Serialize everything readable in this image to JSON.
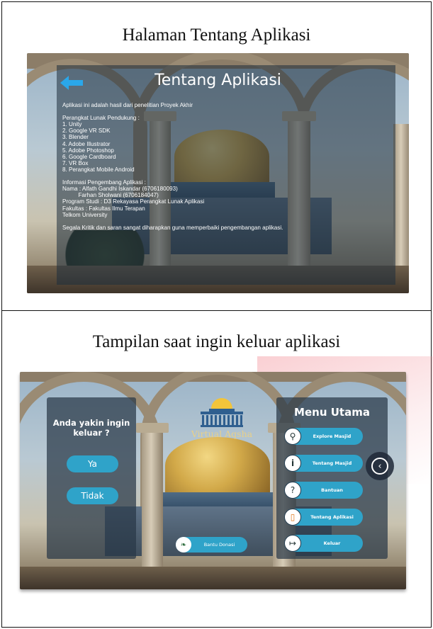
{
  "captions": {
    "top": "Halaman Tentang Aplikasi",
    "bottom": "Tampilan saat ingin keluar aplikasi"
  },
  "about_screen": {
    "title": "Tentang Aplikasi",
    "icon": "back-arrow-icon",
    "body": "Aplikasi ini adalah hasil dari penelitian Proyek Akhir\n\nPerangkat Lunak Pendukung :\n1. Unity\n2. Google VR SDK\n3. Blender\n4. Adobe Illustrator\n5. Adobe Photoshop\n6. Google Cardboard\n7. VR Box\n8. Perangkat Mobile Android\n\nInformasi Pengembang Aplikasi :\nNama : Alfath Gandhi Iskandar (6706180093)\n          Farhan Sholwani (6706184047)\nProgram Studi : D3 Rekayasa Perangkat Lunak Aplikasi\nFakultas : Fakultas Ilmu Terapan\nTelkom University\n\nSegala Kritik dan saran sangat diharapkan guna memperbaiki pengembangan aplikasi."
  },
  "exit_screen": {
    "dialog": {
      "question": "Anda yakin ingin keluar ?",
      "yes": "Ya",
      "no": "Tidak"
    },
    "logo_text": "Virtual Aqsha",
    "menu": {
      "title": "Menu Utama",
      "items": [
        {
          "label": "Explore Masjid",
          "icon": "search-icon"
        },
        {
          "label": "Tentang Masjid",
          "icon": "info-icon"
        },
        {
          "label": "Bantuan",
          "icon": "help-icon"
        },
        {
          "label": "Tentang Aplikasi",
          "icon": "phone-icon"
        },
        {
          "label": "Keluar",
          "icon": "exit-icon"
        }
      ]
    },
    "donation_button": "Bantu Donasi"
  },
  "colors": {
    "button_blue": "#2fa3c9",
    "panel_dark": "#283746",
    "watermark_pink": "#f07882"
  }
}
